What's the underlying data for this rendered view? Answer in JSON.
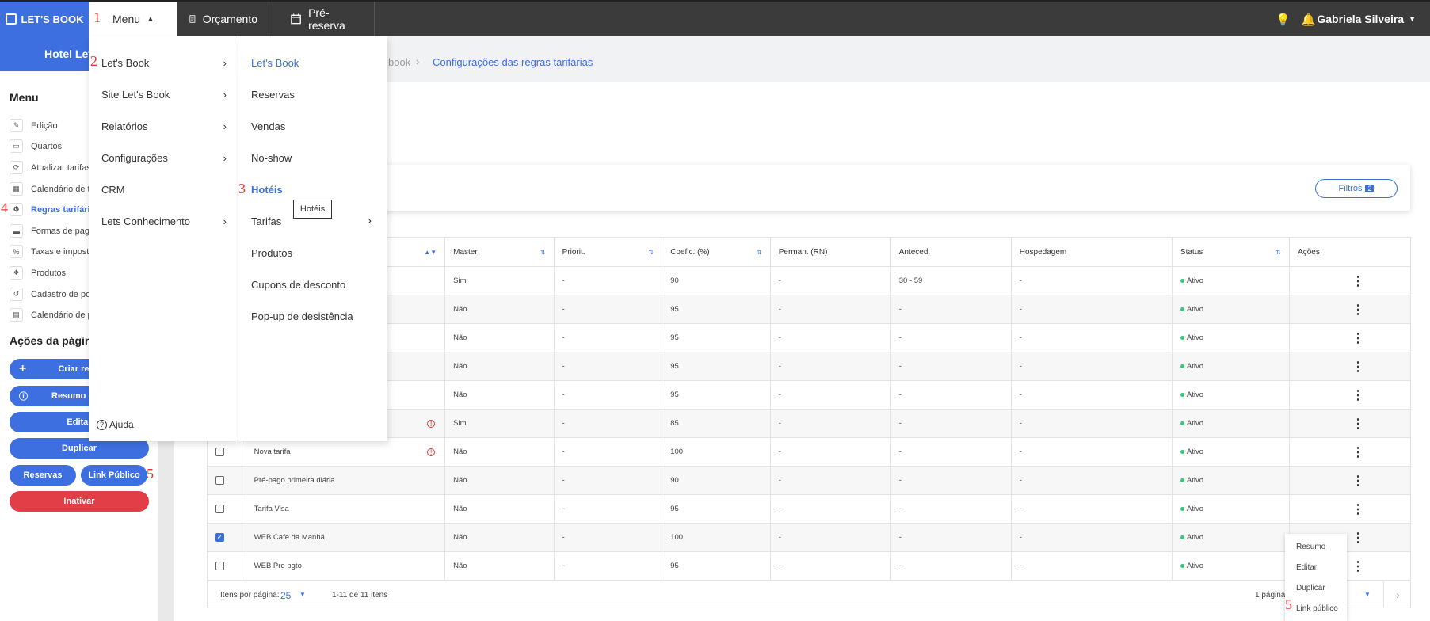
{
  "topbar": {
    "brand": "LET'S BOOK",
    "menu_label": "Menu",
    "nav": [
      "Orçamento",
      "Pré-reserva"
    ],
    "user": "Gabriela Silveira"
  },
  "annotations": [
    "1",
    "2",
    "3",
    "4",
    "5",
    "5"
  ],
  "sidebar": {
    "hotel": "Hotel Lets",
    "menu_title": "Menu",
    "items": [
      {
        "label": "Edição",
        "icon": "pencil-icon"
      },
      {
        "label": "Quartos",
        "icon": "bed-icon"
      },
      {
        "label": "Atualizar tarifas e",
        "icon": "sync-icon"
      },
      {
        "label": "Calendário de ta",
        "icon": "calendar-icon"
      },
      {
        "label": "Regras tarifárias",
        "icon": "rules-icon"
      },
      {
        "label": "Formas de pagar",
        "icon": "card-icon"
      },
      {
        "label": "Taxas e imposto",
        "icon": "percent-icon"
      },
      {
        "label": "Produtos",
        "icon": "product-icon"
      },
      {
        "label": "Cadastro de por",
        "icon": "history-icon"
      },
      {
        "label": "Calendário de po",
        "icon": "calendar-icon"
      }
    ],
    "actions_title": "Ações da página",
    "buttons": {
      "create": "Criar re",
      "summary": "Resumo d",
      "edit": "Editar",
      "duplicate": "Duplicar",
      "reservations": "Reservas",
      "public_link": "Link Público",
      "deactivate": "Inativar"
    }
  },
  "breadcrumb": {
    "partial": "book",
    "current": "Configurações das regras tarifárias"
  },
  "filters": {
    "label": "Filtros",
    "count": "2"
  },
  "menu_dropdown": {
    "col1": [
      "Let's Book",
      "Site Let's Book",
      "Relatórios",
      "Configurações",
      "CRM",
      "Lets Conhecimento"
    ],
    "col1_has_arrow": [
      true,
      true,
      true,
      true,
      false,
      true
    ],
    "help": "Ajuda",
    "col2": [
      "Let's Book",
      "Reservas",
      "Vendas",
      "No-show",
      "Hotéis",
      "Tarifas",
      "Produtos",
      "Cupons de desconto",
      "Pop-up de desistência"
    ],
    "tooltip": "Hotéis"
  },
  "table": {
    "headers": [
      "",
      "",
      "Master",
      "Priorit.",
      "Coefic. (%)",
      "Perman. (RN)",
      "Anteced.",
      "Hospedagem",
      "Status",
      "Ações"
    ],
    "rows": [
      {
        "name": "",
        "master": "Sim",
        "prio": "-",
        "coef": "90",
        "perm": "-",
        "ant": "30 - 59",
        "hosp": "-",
        "status": "Ativo",
        "checked": false,
        "warn": false
      },
      {
        "name": "",
        "master": "Não",
        "prio": "-",
        "coef": "95",
        "perm": "-",
        "ant": "-",
        "hosp": "-",
        "status": "Ativo",
        "checked": false,
        "warn": false
      },
      {
        "name": "",
        "master": "Não",
        "prio": "-",
        "coef": "95",
        "perm": "-",
        "ant": "-",
        "hosp": "-",
        "status": "Ativo",
        "checked": false,
        "warn": false
      },
      {
        "name": "",
        "master": "Não",
        "prio": "-",
        "coef": "95",
        "perm": "-",
        "ant": "-",
        "hosp": "-",
        "status": "Ativo",
        "checked": false,
        "warn": false
      },
      {
        "name": "",
        "master": "Não",
        "prio": "-",
        "coef": "95",
        "perm": "-",
        "ant": "-",
        "hosp": "-",
        "status": "Ativo",
        "checked": false,
        "warn": false
      },
      {
        "name": "",
        "master": "Sim",
        "prio": "-",
        "coef": "85",
        "perm": "-",
        "ant": "-",
        "hosp": "-",
        "status": "Ativo",
        "checked": false,
        "warn": true
      },
      {
        "name": "Nova tarifa",
        "master": "Não",
        "prio": "-",
        "coef": "100",
        "perm": "-",
        "ant": "-",
        "hosp": "-",
        "status": "Ativo",
        "checked": false,
        "warn": true
      },
      {
        "name": "Pré-pago primeira diária",
        "master": "Não",
        "prio": "-",
        "coef": "90",
        "perm": "-",
        "ant": "-",
        "hosp": "-",
        "status": "Ativo",
        "checked": false,
        "warn": false
      },
      {
        "name": "Tarifa Visa",
        "master": "Não",
        "prio": "-",
        "coef": "95",
        "perm": "-",
        "ant": "-",
        "hosp": "-",
        "status": "Ativo",
        "checked": false,
        "warn": false
      },
      {
        "name": "WEB Cafe da Manhã",
        "master": "Não",
        "prio": "-",
        "coef": "100",
        "perm": "-",
        "ant": "-",
        "hosp": "-",
        "status": "Ativo",
        "checked": true,
        "warn": false
      },
      {
        "name": "WEB Pre pgto",
        "master": "Não",
        "prio": "-",
        "coef": "95",
        "perm": "-",
        "ant": "-",
        "hosp": "-",
        "status": "Ativo",
        "checked": false,
        "warn": false
      }
    ]
  },
  "pagination": {
    "per_page_label": "Itens por página:",
    "per_page": "25",
    "range": "1-11 de 11 itens",
    "pages": "1 página"
  },
  "context_menu": [
    "Resumo",
    "Editar",
    "Duplicar",
    "Link público"
  ],
  "colors": {
    "accent": "#3d6fe0",
    "danger": "#e23e48",
    "topbar": "#3b3b3b",
    "status": "#2ecc71"
  }
}
